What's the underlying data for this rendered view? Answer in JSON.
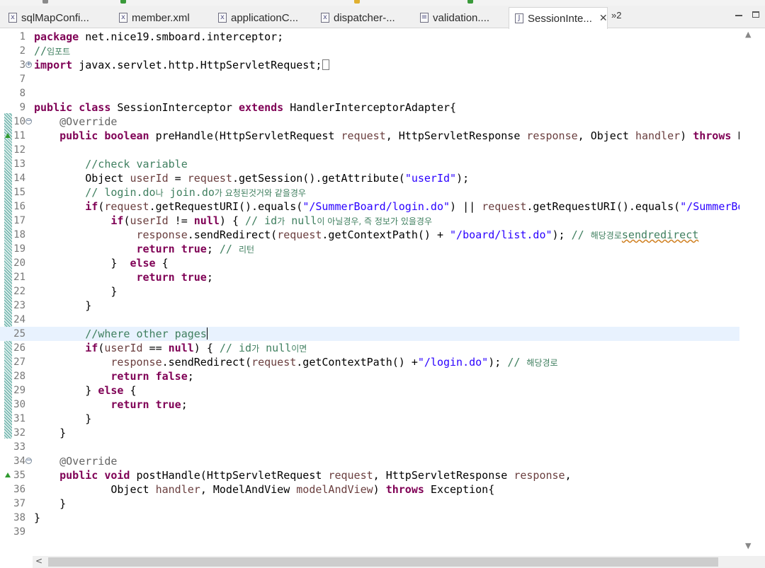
{
  "tabs": [
    {
      "label": "sqlMapConfi...",
      "icon": "xml-file-icon",
      "glyph": "x",
      "active": false
    },
    {
      "label": "member.xml",
      "icon": "xml-file-icon",
      "glyph": "x",
      "active": false
    },
    {
      "label": "applicationC...",
      "icon": "xml-file-icon",
      "glyph": "x",
      "active": false
    },
    {
      "label": "dispatcher-...",
      "icon": "xml-file-icon",
      "glyph": "x",
      "active": false
    },
    {
      "label": "validation....",
      "icon": "properties-file-icon",
      "glyph": "≡",
      "active": false
    },
    {
      "label": "SessionInte...",
      "icon": "java-file-icon",
      "glyph": "J",
      "active": true
    }
  ],
  "tab_overflow": "»2",
  "active_tab_close": "✕",
  "editor": {
    "current_line": 25,
    "lines": [
      {
        "n": "1",
        "code": "<span class='kw'>package</span> net.nice19.smboard.interceptor;"
      },
      {
        "n": "2",
        "code": "<span class='cm'>//<span class='kr'>임포트</span></span>"
      },
      {
        "n": "3",
        "fold": "+",
        "code": "<span class='kw'>import</span> javax.servlet.http.HttpServletRequest;<span class='fbox'></span>"
      },
      {
        "n": "7",
        "code": ""
      },
      {
        "n": "8",
        "code": ""
      },
      {
        "n": "9",
        "code": "<span class='kw'>public</span> <span class='kw'>class</span> SessionInterceptor <span class='kw'>extends</span> HandlerInterceptorAdapter{"
      },
      {
        "n": "10",
        "fold": "-",
        "code": "    <span class='an'>@Override</span>"
      },
      {
        "n": "11",
        "mark": "override",
        "code": "    <span class='kw'>public</span> <span class='kw'>boolean</span> preHandle(HttpServletRequest <span class='fd'>request</span>, HttpServletResponse <span class='fd'>response</span>, Object <span class='fd'>handler</span>) <span class='kw'>throws</span> E"
      },
      {
        "n": "12",
        "code": ""
      },
      {
        "n": "13",
        "code": "        <span class='cm'>//check variable</span>"
      },
      {
        "n": "14",
        "code": "        Object <span class='fd'>userId</span> = <span class='fd'>request</span>.getSession().getAttribute(<span class='st'>\"userId\"</span>);"
      },
      {
        "n": "15",
        "code": "        <span class='cm'>// login.do<span class='kr'>나</span> join.do<span class='kr'>가 요청된것거와 같을경우</span></span>"
      },
      {
        "n": "16",
        "code": "        <span class='kw'>if</span>(<span class='fd'>request</span>.getRequestURI().equals(<span class='st'>\"/SummerBoard/login.do\"</span>) || <span class='fd'>request</span>.getRequestURI().equals(<span class='st'>\"/SummerBo</span>"
      },
      {
        "n": "17",
        "code": "            <span class='kw'>if</span>(<span class='fd'>userId</span> != <span class='kw'>null</span>) { <span class='cm'>// id<span class='kr'>가</span> null<span class='kr'>이 아닐경우, 즉 정보가 있을경우</span></span>"
      },
      {
        "n": "18",
        "code": "                <span class='fd'>response</span>.sendRedirect(<span class='fd'>request</span>.getContextPath() + <span class='st'>\"/board/list.do\"</span>); <span class='cm'>// <span class='kr'>해당경로</span><span class='sq'>sendredirect</span></span>"
      },
      {
        "n": "19",
        "code": "                <span class='kw'>return</span> <span class='kw'>true</span>; <span class='cm'>// <span class='kr'>리턴</span></span>"
      },
      {
        "n": "20",
        "code": "            }  <span class='kw'>else</span> {"
      },
      {
        "n": "21",
        "code": "                <span class='kw'>return</span> <span class='kw'>true</span>;"
      },
      {
        "n": "22",
        "code": "            }"
      },
      {
        "n": "23",
        "code": "        }"
      },
      {
        "n": "24",
        "code": ""
      },
      {
        "n": "25",
        "code": "        <span class='cm'>//where other pages</span><span class='caret'></span>"
      },
      {
        "n": "26",
        "code": "        <span class='kw'>if</span>(<span class='fd'>userId</span> == <span class='kw'>null</span>) { <span class='cm'>// id<span class='kr'>가</span> null<span class='kr'>이면</span></span>"
      },
      {
        "n": "27",
        "code": "            <span class='fd'>response</span>.sendRedirect(<span class='fd'>request</span>.getContextPath() +<span class='st'>\"/login.do\"</span>); <span class='cm'>// <span class='kr'>해당경로</span></span>"
      },
      {
        "n": "28",
        "code": "            <span class='kw'>return</span> <span class='kw'>false</span>;"
      },
      {
        "n": "29",
        "code": "        } <span class='kw'>else</span> {"
      },
      {
        "n": "30",
        "code": "            <span class='kw'>return</span> <span class='kw'>true</span>;"
      },
      {
        "n": "31",
        "code": "        }"
      },
      {
        "n": "32",
        "code": "    }"
      },
      {
        "n": "33",
        "code": ""
      },
      {
        "n": "34",
        "fold": "-",
        "code": "    <span class='an'>@Override</span>"
      },
      {
        "n": "35",
        "mark": "override",
        "code": "    <span class='kw'>public</span> <span class='kw'>void</span> postHandle(HttpServletRequest <span class='fd'>request</span>, HttpServletResponse <span class='fd'>response</span>,"
      },
      {
        "n": "36",
        "code": "            Object <span class='fd'>handler</span>, ModelAndView <span class='fd'>modelAndView</span>) <span class='kw'>throws</span> Exception{"
      },
      {
        "n": "37",
        "code": "    }"
      },
      {
        "n": "38",
        "code": "}"
      },
      {
        "n": "39",
        "code": ""
      }
    ]
  },
  "colors": {
    "keyword": "#7f0055",
    "comment": "#3f7f5f",
    "string": "#2a00ff",
    "field": "#6a3e3e",
    "annotation": "#646464",
    "current_line_bg": "#e8f2fe"
  }
}
